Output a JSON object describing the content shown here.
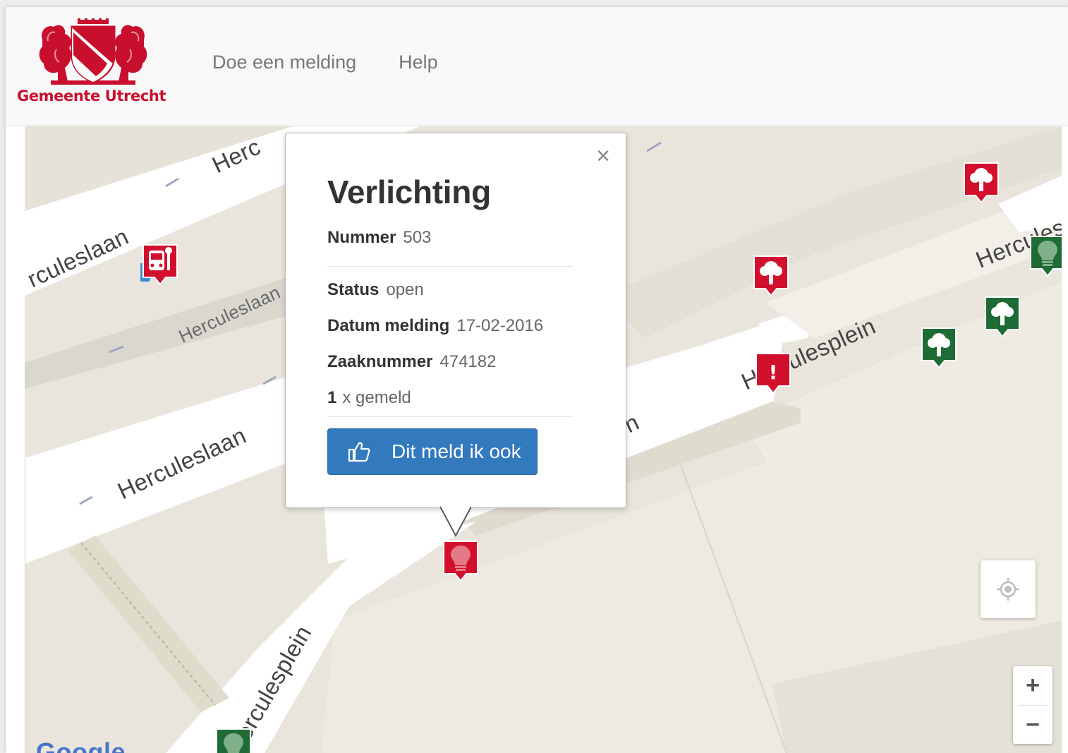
{
  "header": {
    "logo_text": "Gemeente Utrecht",
    "nav": [
      "Doe een melding",
      "Help"
    ]
  },
  "map": {
    "street_labels": [
      "Herc",
      "rculeslaan",
      "Herculeslaan",
      "Herculeslaan",
      "Herculesplein",
      "Herculesplein",
      "Herculesp",
      "n"
    ],
    "google_watermark": "Google",
    "zoom_in": "+",
    "zoom_out": "−",
    "markers": [
      {
        "type": "bus-stop",
        "color": "#d2102e"
      },
      {
        "type": "tree",
        "color": "#d2102e"
      },
      {
        "type": "tree",
        "color": "#d2102e"
      },
      {
        "type": "warning",
        "color": "#d2102e",
        "glyph": "!"
      },
      {
        "type": "tree",
        "color": "#1f6b36"
      },
      {
        "type": "tree",
        "color": "#1f6b36"
      },
      {
        "type": "lightbulb",
        "color": "#1f6b36"
      },
      {
        "type": "lightbulb",
        "color": "#d2102e"
      },
      {
        "type": "lightbulb",
        "color": "#1f6b36"
      }
    ]
  },
  "popup": {
    "title": "Verlichting",
    "fields": [
      {
        "label": "Nummer",
        "value": "503"
      },
      {
        "label": "Status",
        "value": "open"
      },
      {
        "label": "Datum melding",
        "value": "17-02-2016"
      },
      {
        "label": "Zaaknummer",
        "value": "474182"
      }
    ],
    "report_count": "1",
    "report_suffix": "x gemeld",
    "button_label": "Dit meld ik ook",
    "close": "×"
  },
  "colors": {
    "brand_red": "#c8102e",
    "button_blue": "#3279be",
    "marker_red": "#d2102e",
    "marker_green": "#1f6b36"
  }
}
